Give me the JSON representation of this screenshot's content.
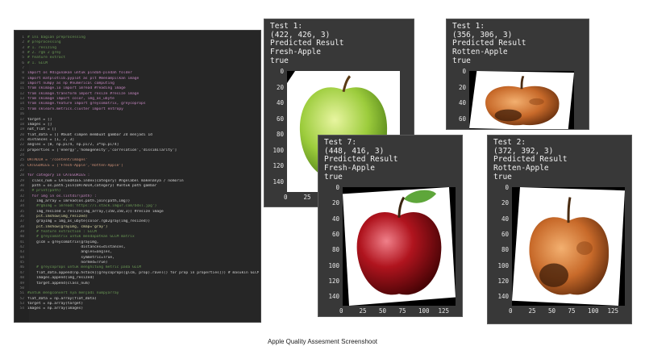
{
  "code_editor": {
    "lines": [
      {
        "n": "1",
        "text": "# ini bagian preprocessing",
        "kind": "cm"
      },
      {
        "n": "2",
        "text": "# preprocessing",
        "kind": "cm"
      },
      {
        "n": "3",
        "text": "# 1. resizing",
        "kind": "cm"
      },
      {
        "n": "4",
        "text": "# 2. rgb 2 grey",
        "kind": "cm"
      },
      {
        "n": "5",
        "text": "# feature extract",
        "kind": "cm"
      },
      {
        "n": "6",
        "text": "# 1. GLCM",
        "kind": "cm"
      },
      {
        "n": "7",
        "text": "",
        "kind": "tx"
      },
      {
        "n": "8",
        "text": "import os #digunakan untuk pindah-pindah folder",
        "kind": "kw"
      },
      {
        "n": "9",
        "text": "import matplotlib.pyplot as plt #menampilkan image",
        "kind": "kw"
      },
      {
        "n": "10",
        "text": "import numpy as np #numerical computing",
        "kind": "kw"
      },
      {
        "n": "11",
        "text": "from skimage.io import imread #reading image",
        "kind": "kw"
      },
      {
        "n": "12",
        "text": "from skimage.transform import resize #resize image",
        "kind": "kw"
      },
      {
        "n": "13",
        "text": "from skimage import color, img_as_ubyte",
        "kind": "kw"
      },
      {
        "n": "14",
        "text": "from skimage.feature import greycomatrix, greycoprops",
        "kind": "kw"
      },
      {
        "n": "15",
        "text": "from sklearn.metrics.cluster import entropy",
        "kind": "kw"
      },
      {
        "n": "16",
        "text": "",
        "kind": "tx"
      },
      {
        "n": "17",
        "text": "target = []",
        "kind": "tx"
      },
      {
        "n": "18",
        "text": "images = []",
        "kind": "tx"
      },
      {
        "n": "19",
        "text": "not_flat = []",
        "kind": "tx"
      },
      {
        "n": "20",
        "text": "flat_data = [] #buat simpen membuat gambar 2d menjadi 1d",
        "kind": "tx"
      },
      {
        "n": "21",
        "text": "distances = [1, 2, 3]",
        "kind": "tx"
      },
      {
        "n": "22",
        "text": "angles = [0, np.pi/4, np.pi/2, 3*np.pi/4]",
        "kind": "tx"
      },
      {
        "n": "23",
        "text": "properties = ['energy','homogeneity','correlation','dissimilarity']",
        "kind": "tx"
      },
      {
        "n": "24",
        "text": "",
        "kind": "tx"
      },
      {
        "n": "25",
        "text": "DATADIR = '/content/images'",
        "kind": "st"
      },
      {
        "n": "26",
        "text": "CATEGORIES = ['Fresh-Apple','Rotten-Apple']",
        "kind": "st"
      },
      {
        "n": "27",
        "text": "",
        "kind": "tx"
      },
      {
        "n": "28",
        "text": "for category in CATEGORIES :",
        "kind": "kw"
      },
      {
        "n": "29",
        "text": "  class_num = CATEGORIES.index(category) #ngelabel makenanya / nomorin",
        "kind": "tx"
      },
      {
        "n": "30",
        "text": "  path = os.path.join(DATADIR,category) #untuk path gambar",
        "kind": "tx"
      },
      {
        "n": "31",
        "text": "  # print(path)",
        "kind": "cm"
      },
      {
        "n": "32",
        "text": "  for img in os.listdir(path) :",
        "kind": "kw"
      },
      {
        "n": "33",
        "text": "    img_array = imread(os.path.join(path,img))",
        "kind": "tx"
      },
      {
        "n": "34",
        "text": "    #rgbImg = imread('https://i.stack.imgur.com/bdxl.jpg')",
        "kind": "cm"
      },
      {
        "n": "35",
        "text": "    img_resized = resize(img_array,(150,150,3)) #resize image",
        "kind": "tx"
      },
      {
        "n": "36",
        "text": "    plt.imshow(img_resized)",
        "kind": "fn"
      },
      {
        "n": "37",
        "text": "    grayImg = img_as_ubyte(color.rgb2gray(img_resized))",
        "kind": "tx"
      },
      {
        "n": "38",
        "text": "    plt.imshow(grayImg, cmap='gray')",
        "kind": "fn"
      },
      {
        "n": "39",
        "text": "    # feature extraction : GLCM",
        "kind": "cm"
      },
      {
        "n": "40",
        "text": "    # greycomatrix untuk mendapatkan GLCM matrix",
        "kind": "cm"
      },
      {
        "n": "41",
        "text": "    glcm = greycomatrix(grayImg,",
        "kind": "tx"
      },
      {
        "n": "42",
        "text": "                        distances=distances,",
        "kind": "tx"
      },
      {
        "n": "43",
        "text": "                        angles=angles,",
        "kind": "tx"
      },
      {
        "n": "44",
        "text": "                        symmetric=True,",
        "kind": "tx"
      },
      {
        "n": "45",
        "text": "                        normed=True)",
        "kind": "tx"
      },
      {
        "n": "46",
        "text": "    # greycoprops untuk menghitung metric pada GLCM",
        "kind": "cm"
      },
      {
        "n": "47",
        "text": "    flat_data.append(np.hstack([greycoprops(glcm, prop).ravel() for prop in properties])) # masukin GLCM nya ke array",
        "kind": "tx"
      },
      {
        "n": "48",
        "text": "    images.append(img_resized)",
        "kind": "tx"
      },
      {
        "n": "49",
        "text": "    target.append(class_num)",
        "kind": "tx"
      },
      {
        "n": "50",
        "text": "",
        "kind": "tx"
      },
      {
        "n": "51",
        "text": "#untuk mengconvert nya menjadi numpyarray",
        "kind": "cm"
      },
      {
        "n": "52",
        "text": "flat_data = np.array(flat_data)",
        "kind": "tx"
      },
      {
        "n": "53",
        "text": "target = np.array(target)",
        "kind": "tx"
      },
      {
        "n": "54",
        "text": "images = np.array(images)",
        "kind": "tx"
      }
    ]
  },
  "results": [
    {
      "test_label": "Test 1:",
      "shape": "(422, 426, 3)",
      "result_label": "Predicted Result",
      "prediction": "Fresh-Apple",
      "status": "true",
      "fruit": "green-apple",
      "y_ticks": [
        "0",
        "20",
        "40",
        "60",
        "80",
        "100",
        "120",
        "140"
      ],
      "x_ticks": [
        "0",
        "25"
      ]
    },
    {
      "test_label": "Test 1:",
      "shape": "(356, 306, 3)",
      "result_label": "Predicted Result",
      "prediction": "Rotten-Apple",
      "status": "true",
      "fruit": "rotten-apple",
      "y_ticks": [
        "0",
        "20",
        "40",
        "60",
        "80"
      ],
      "x_ticks": []
    },
    {
      "test_label": "Test 7:",
      "shape": "(448, 416, 3)",
      "result_label": "Predicted Result",
      "prediction": "Fresh-Apple",
      "status": "true",
      "fruit": "red-apple",
      "y_ticks": [
        "0",
        "20",
        "40",
        "60",
        "80",
        "100",
        "120",
        "140"
      ],
      "x_ticks": [
        "0",
        "25",
        "50",
        "75",
        "100",
        "125"
      ]
    },
    {
      "test_label": "Test 2:",
      "shape": "(372, 392, 3)",
      "result_label": "Predicted Result",
      "prediction": "Rotten-Apple",
      "status": "true",
      "fruit": "rotten-apple",
      "y_ticks": [
        "0",
        "20",
        "40",
        "60",
        "80",
        "100",
        "120",
        "140"
      ],
      "x_ticks": [
        "0",
        "25",
        "50",
        "75",
        "100",
        "125"
      ]
    }
  ],
  "caption": "Apple Quality Assesment Screenshoot",
  "colors": {
    "editor_bg": "#262626",
    "panel_bg": "#383838",
    "output_text": "#f0f0f0",
    "comment": "#6a9955",
    "keyword": "#c586c0",
    "string": "#ce9178"
  }
}
